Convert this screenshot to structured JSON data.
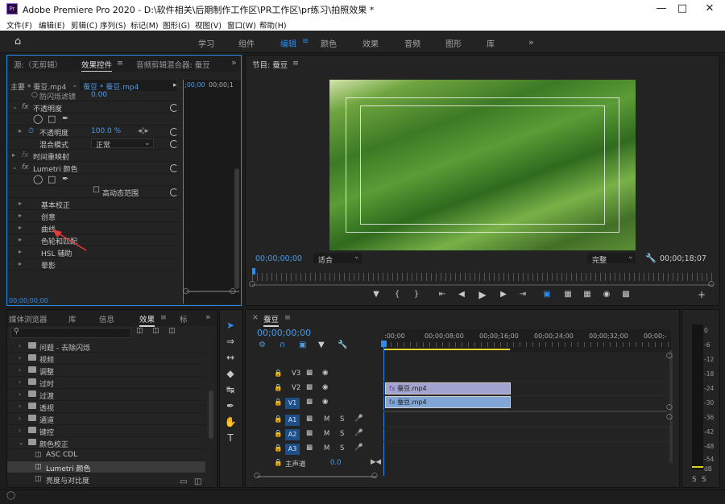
{
  "window": {
    "app_icon": "Pr",
    "title": "Adobe Premiere Pro 2020 - D:\\软件相关\\后期制作工作区\\PR工作区\\pr练习\\拍照效果 *"
  },
  "menu": [
    "文件(F)",
    "编辑(E)",
    "剪辑(C)",
    "序列(S)",
    "标记(M)",
    "图形(G)",
    "视图(V)",
    "窗口(W)",
    "帮助(H)"
  ],
  "workspaces": [
    "学习",
    "组件",
    "编辑",
    "颜色",
    "效果",
    "音频",
    "图形",
    "库"
  ],
  "effect_controls": {
    "tabs": [
      "源:（无剪辑）",
      "效果控件",
      "音频剪辑混合器: 蚕豆"
    ],
    "master_label": "主要 * 蚕豆.mp4",
    "sequence_label": "蚕豆 * 蚕豆.mp4",
    "time_a": ";00;00",
    "time_b": "00;00;1",
    "anti_flicker": "防闪烁滤镜",
    "anti_flicker_value": "0.00",
    "opacity_section": "不透明度",
    "opacity_label": "不透明度",
    "opacity_value": "100.0 %",
    "blend_label": "混合模式",
    "blend_value": "正常",
    "time_remap": "时间重映射",
    "lumetri": "Lumetri 颜色",
    "hdr": "高动态范围",
    "lumetri_items": [
      "基本校正",
      "创意",
      "曲线",
      "色轮和匹配",
      "HSL 辅助",
      "晕影"
    ]
  },
  "program": {
    "title": "节目: 蚕豆",
    "timecode": "00;00;00;00",
    "fit": "适合",
    "quality": "完整",
    "duration": "00;00;18;07"
  },
  "media_browser": {
    "tabs": [
      "媒体浏览器",
      "库",
      "信息",
      "效果",
      "标"
    ],
    "items": [
      "问题 - 去除闪烁",
      "视频",
      "调整",
      "过时",
      "过渡",
      "透视",
      "通道",
      "键控",
      "颜色校正",
      "ASC CDL",
      "Lumetri 颜色",
      "亮度与对比度"
    ]
  },
  "timeline": {
    "tab": "蚕豆",
    "timecode": "00;00;00;00",
    "ruler": [
      ":00;00",
      "00;00;08;00",
      "00;00;16;00",
      "00;00;24;00",
      "00;00;32;00",
      "00;00;-"
    ],
    "tracks": [
      "V3",
      "V2",
      "V1",
      "A1",
      "A2",
      "A3"
    ],
    "master": "主声道",
    "master_value": "0.0",
    "clip_v2": "蚕豆.mp4",
    "clip_v1": "蚕豆.mp4"
  },
  "meter_scale": [
    "0",
    "-6",
    "-12",
    "-18",
    "-24",
    "-30",
    "-36",
    "-42",
    "-48",
    "-54",
    "dB"
  ],
  "colors": {
    "accent": "#2d8ceb",
    "panel": "#232323",
    "clip_v2": "#a3a3cf",
    "clip_v1": "#7fa6d6"
  }
}
